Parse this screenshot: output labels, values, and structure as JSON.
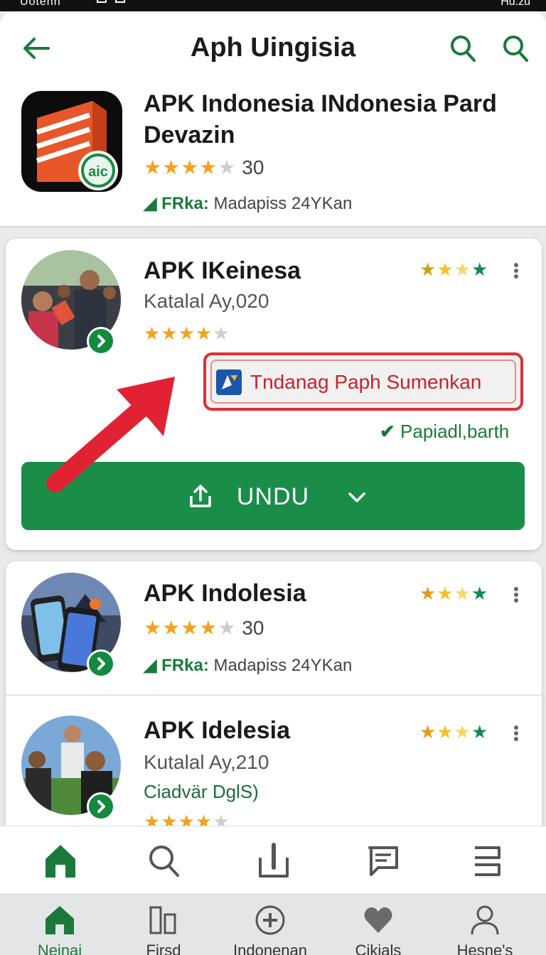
{
  "status_bar": {
    "left_text": "Uotenn",
    "right_text": "Hu.zu"
  },
  "header": {
    "title": "Aph Uingisia"
  },
  "top_app": {
    "title": "APK Indonesia INdonesia Pard Devazin",
    "rating_count": "30",
    "meta_label": "FRka:",
    "meta_text": "Madapiss 24YKan"
  },
  "list": [
    {
      "title": "APK IKeinesa",
      "subtitle": "Katalal Ay,020",
      "promo_text": "Tndanag Paph Sumenkan",
      "verified_text": "Papiadl,barth",
      "download_label": "UNDU"
    },
    {
      "title": "APK Indolesia",
      "rating_count": "30",
      "meta_label": "FRka:",
      "meta_text": "Madapiss 24YKan"
    },
    {
      "title": "APK Idelesia",
      "subtitle": "Kutalal Ay,210",
      "tagline": "Ciadvär DglS)"
    }
  ],
  "bottom_tabs": [
    {
      "label": "Neinai",
      "icon": "home-icon"
    },
    {
      "label": "Firsd",
      "icon": "panels-icon"
    },
    {
      "label": "Indonenan",
      "icon": "plus-circle-icon"
    },
    {
      "label": "Cikials",
      "icon": "heart-icon"
    },
    {
      "label": "Hesne's",
      "icon": "person-icon"
    }
  ],
  "colors": {
    "brand_green": "#1a8d48",
    "alert_red": "#dd2f36",
    "star": "#f4a21d"
  }
}
